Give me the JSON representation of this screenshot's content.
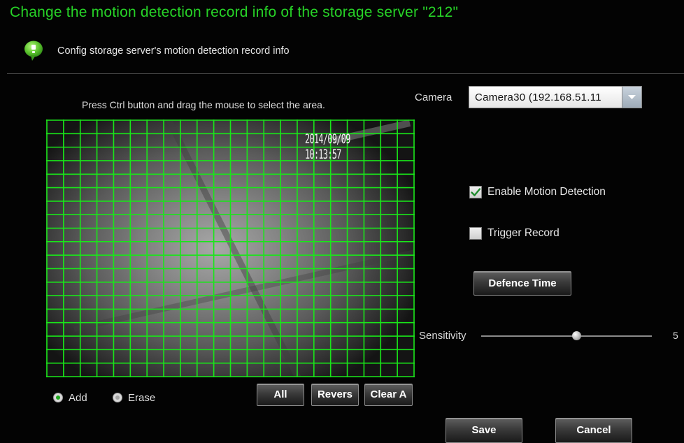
{
  "header": {
    "title": "Change the motion detection record info of the storage server \"212\"",
    "subtitle": "Config storage server's motion detection record info",
    "title_color": "#27d227"
  },
  "preview": {
    "instruction": "Press Ctrl button and drag the mouse to select the area.",
    "timestamp": "2014/09/09 10:13:57",
    "grid_columns": 22,
    "grid_rows": 19,
    "grid_color": "#19e619"
  },
  "area_mode": {
    "options": [
      {
        "label": "Add",
        "selected": true
      },
      {
        "label": "Erase",
        "selected": false
      }
    ]
  },
  "grid_buttons": {
    "all": "All",
    "reverse": "Revers",
    "clear": "Clear A"
  },
  "camera": {
    "label": "Camera",
    "selected": "Camera30  (192.168.51.11"
  },
  "options": {
    "enable_motion_label": "Enable Motion Detection",
    "enable_motion_checked": true,
    "trigger_record_label": "Trigger Record",
    "trigger_record_checked": false,
    "defence_time_label": "Defence Time"
  },
  "sensitivity": {
    "label": "Sensitivity",
    "value": "5",
    "level_fraction": 0.56
  },
  "footer": {
    "save": "Save",
    "cancel": "Cancel"
  },
  "icons": {
    "tip": "info-bubble-icon",
    "check": "checkmark-icon",
    "dropdown": "dropdown-arrow-icon"
  }
}
